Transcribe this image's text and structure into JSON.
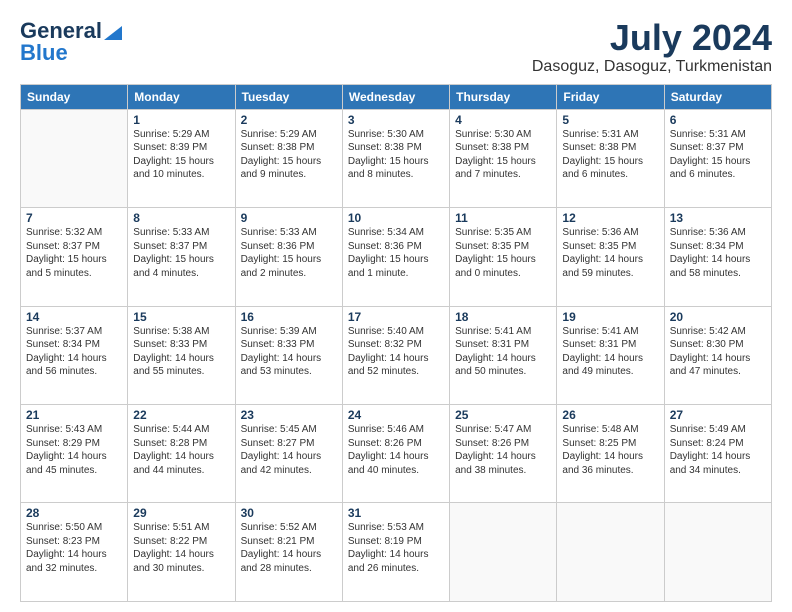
{
  "logo": {
    "line1": "General",
    "line2": "Blue"
  },
  "header": {
    "month": "July 2024",
    "location": "Dasoguz, Dasoguz, Turkmenistan"
  },
  "weekdays": [
    "Sunday",
    "Monday",
    "Tuesday",
    "Wednesday",
    "Thursday",
    "Friday",
    "Saturday"
  ],
  "weeks": [
    [
      {
        "day": "",
        "info": ""
      },
      {
        "day": "1",
        "info": "Sunrise: 5:29 AM\nSunset: 8:39 PM\nDaylight: 15 hours\nand 10 minutes."
      },
      {
        "day": "2",
        "info": "Sunrise: 5:29 AM\nSunset: 8:38 PM\nDaylight: 15 hours\nand 9 minutes."
      },
      {
        "day": "3",
        "info": "Sunrise: 5:30 AM\nSunset: 8:38 PM\nDaylight: 15 hours\nand 8 minutes."
      },
      {
        "day": "4",
        "info": "Sunrise: 5:30 AM\nSunset: 8:38 PM\nDaylight: 15 hours\nand 7 minutes."
      },
      {
        "day": "5",
        "info": "Sunrise: 5:31 AM\nSunset: 8:38 PM\nDaylight: 15 hours\nand 6 minutes."
      },
      {
        "day": "6",
        "info": "Sunrise: 5:31 AM\nSunset: 8:37 PM\nDaylight: 15 hours\nand 6 minutes."
      }
    ],
    [
      {
        "day": "7",
        "info": "Sunrise: 5:32 AM\nSunset: 8:37 PM\nDaylight: 15 hours\nand 5 minutes."
      },
      {
        "day": "8",
        "info": "Sunrise: 5:33 AM\nSunset: 8:37 PM\nDaylight: 15 hours\nand 4 minutes."
      },
      {
        "day": "9",
        "info": "Sunrise: 5:33 AM\nSunset: 8:36 PM\nDaylight: 15 hours\nand 2 minutes."
      },
      {
        "day": "10",
        "info": "Sunrise: 5:34 AM\nSunset: 8:36 PM\nDaylight: 15 hours\nand 1 minute."
      },
      {
        "day": "11",
        "info": "Sunrise: 5:35 AM\nSunset: 8:35 PM\nDaylight: 15 hours\nand 0 minutes."
      },
      {
        "day": "12",
        "info": "Sunrise: 5:36 AM\nSunset: 8:35 PM\nDaylight: 14 hours\nand 59 minutes."
      },
      {
        "day": "13",
        "info": "Sunrise: 5:36 AM\nSunset: 8:34 PM\nDaylight: 14 hours\nand 58 minutes."
      }
    ],
    [
      {
        "day": "14",
        "info": "Sunrise: 5:37 AM\nSunset: 8:34 PM\nDaylight: 14 hours\nand 56 minutes."
      },
      {
        "day": "15",
        "info": "Sunrise: 5:38 AM\nSunset: 8:33 PM\nDaylight: 14 hours\nand 55 minutes."
      },
      {
        "day": "16",
        "info": "Sunrise: 5:39 AM\nSunset: 8:33 PM\nDaylight: 14 hours\nand 53 minutes."
      },
      {
        "day": "17",
        "info": "Sunrise: 5:40 AM\nSunset: 8:32 PM\nDaylight: 14 hours\nand 52 minutes."
      },
      {
        "day": "18",
        "info": "Sunrise: 5:41 AM\nSunset: 8:31 PM\nDaylight: 14 hours\nand 50 minutes."
      },
      {
        "day": "19",
        "info": "Sunrise: 5:41 AM\nSunset: 8:31 PM\nDaylight: 14 hours\nand 49 minutes."
      },
      {
        "day": "20",
        "info": "Sunrise: 5:42 AM\nSunset: 8:30 PM\nDaylight: 14 hours\nand 47 minutes."
      }
    ],
    [
      {
        "day": "21",
        "info": "Sunrise: 5:43 AM\nSunset: 8:29 PM\nDaylight: 14 hours\nand 45 minutes."
      },
      {
        "day": "22",
        "info": "Sunrise: 5:44 AM\nSunset: 8:28 PM\nDaylight: 14 hours\nand 44 minutes."
      },
      {
        "day": "23",
        "info": "Sunrise: 5:45 AM\nSunset: 8:27 PM\nDaylight: 14 hours\nand 42 minutes."
      },
      {
        "day": "24",
        "info": "Sunrise: 5:46 AM\nSunset: 8:26 PM\nDaylight: 14 hours\nand 40 minutes."
      },
      {
        "day": "25",
        "info": "Sunrise: 5:47 AM\nSunset: 8:26 PM\nDaylight: 14 hours\nand 38 minutes."
      },
      {
        "day": "26",
        "info": "Sunrise: 5:48 AM\nSunset: 8:25 PM\nDaylight: 14 hours\nand 36 minutes."
      },
      {
        "day": "27",
        "info": "Sunrise: 5:49 AM\nSunset: 8:24 PM\nDaylight: 14 hours\nand 34 minutes."
      }
    ],
    [
      {
        "day": "28",
        "info": "Sunrise: 5:50 AM\nSunset: 8:23 PM\nDaylight: 14 hours\nand 32 minutes."
      },
      {
        "day": "29",
        "info": "Sunrise: 5:51 AM\nSunset: 8:22 PM\nDaylight: 14 hours\nand 30 minutes."
      },
      {
        "day": "30",
        "info": "Sunrise: 5:52 AM\nSunset: 8:21 PM\nDaylight: 14 hours\nand 28 minutes."
      },
      {
        "day": "31",
        "info": "Sunrise: 5:53 AM\nSunset: 8:19 PM\nDaylight: 14 hours\nand 26 minutes."
      },
      {
        "day": "",
        "info": ""
      },
      {
        "day": "",
        "info": ""
      },
      {
        "day": "",
        "info": ""
      }
    ]
  ]
}
